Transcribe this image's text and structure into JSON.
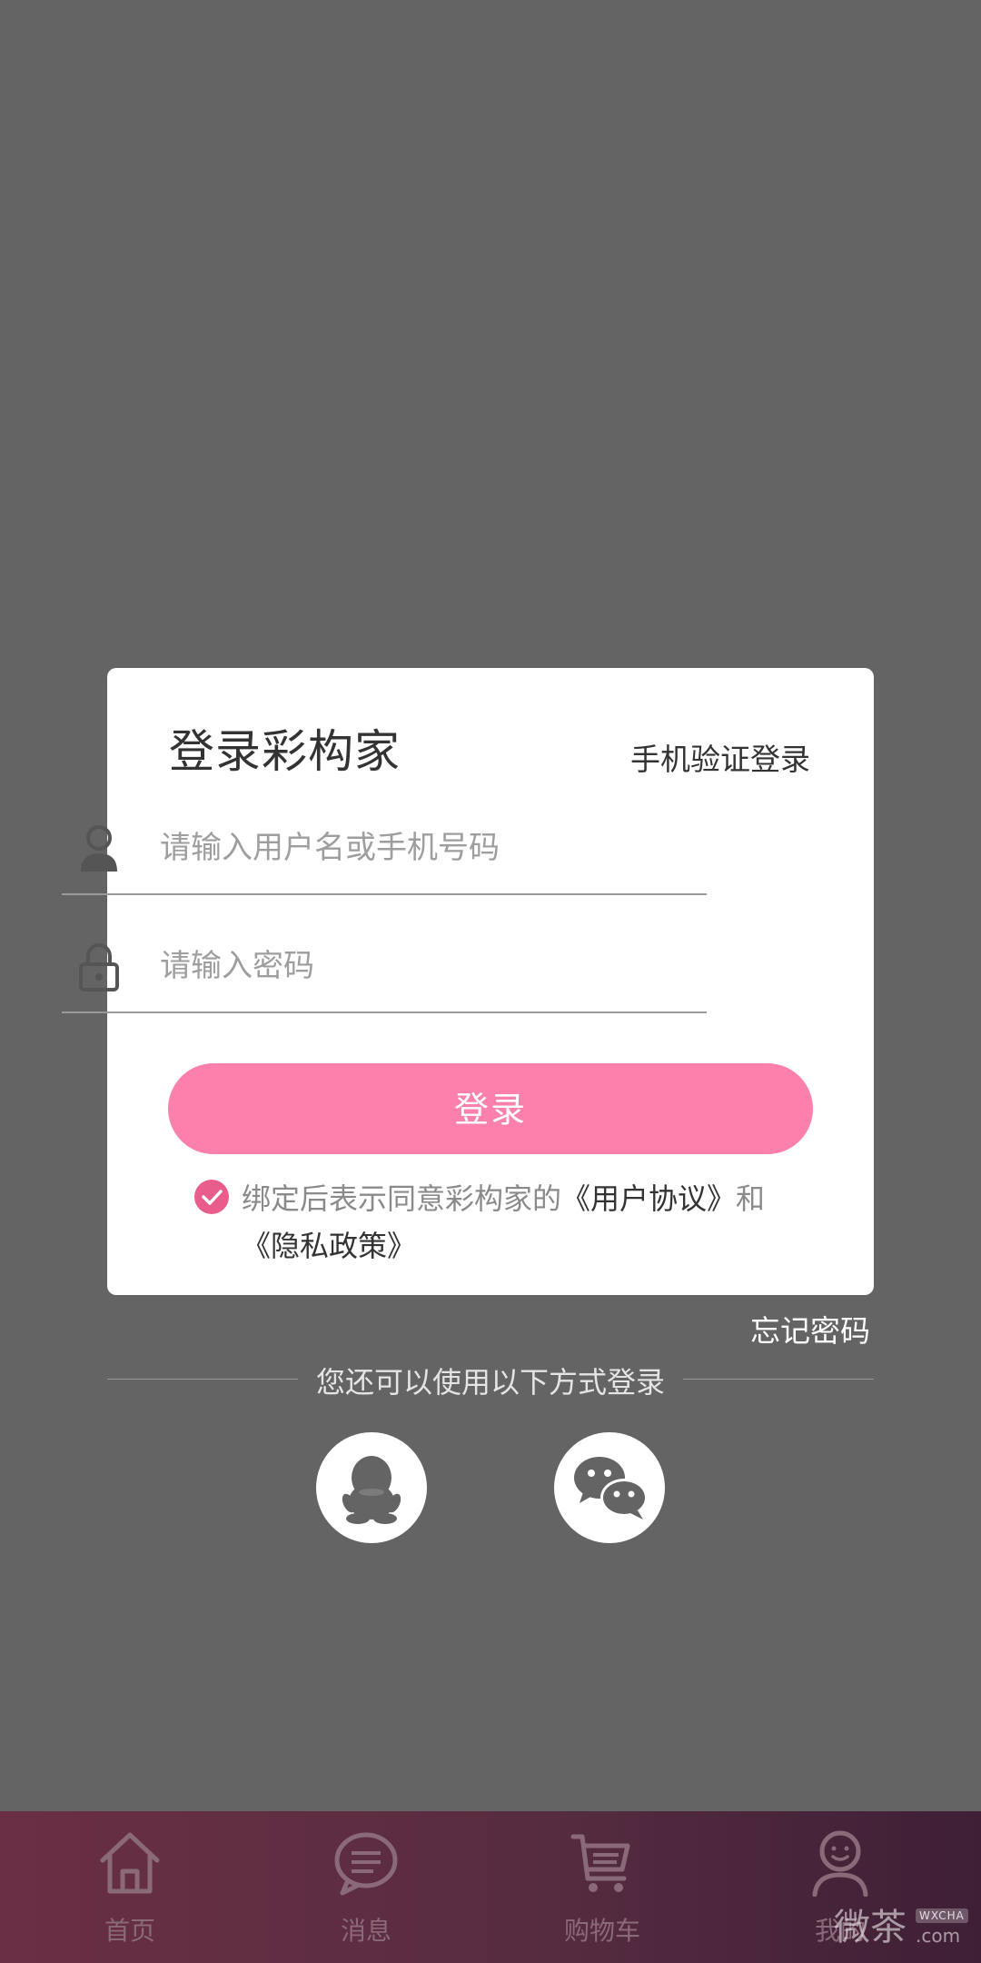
{
  "dialog": {
    "title": "登录彩构家",
    "phone_login": "手机验证登录",
    "username_placeholder": "请输入用户名或手机号码",
    "password_placeholder": "请输入密码",
    "login_button": "登录",
    "agreement": {
      "checked": true,
      "prefix": "绑定后表示同意彩构家的",
      "user_agreement": "《用户协议》",
      "and": "和",
      "privacy_policy": "《隐私政策》"
    }
  },
  "forgot_password": "忘记密码",
  "other_login": {
    "label": "您还可以使用以下方式登录",
    "methods": [
      "qq-icon",
      "wechat-icon"
    ]
  },
  "tabbar": {
    "items": [
      {
        "label": "首页",
        "icon": "home-icon"
      },
      {
        "label": "消息",
        "icon": "message-icon"
      },
      {
        "label": "购物车",
        "icon": "cart-icon"
      },
      {
        "label": "我的",
        "icon": "profile-icon"
      }
    ]
  },
  "watermark": {
    "text": "微茶",
    "badge": "WXCHA",
    "domain": ".com"
  },
  "colors": {
    "overlay": "#646464",
    "accent": "#fd7fab",
    "check": "#e85d8b",
    "tabbar_start": "#6a2f44",
    "tabbar_end": "#3e1f36"
  }
}
